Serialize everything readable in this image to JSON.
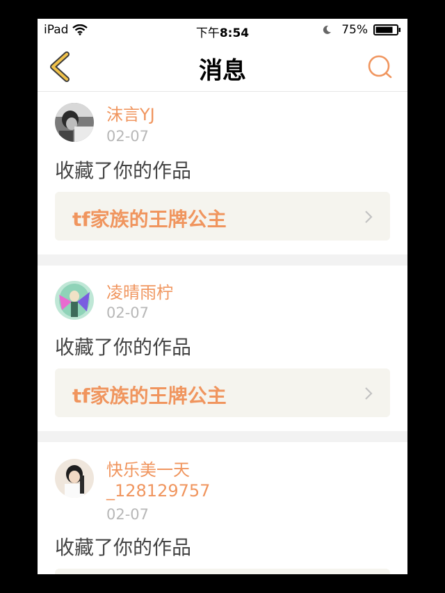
{
  "status": {
    "device": "iPad",
    "time_prefix": "下午",
    "time": "8:54",
    "battery": "75%"
  },
  "nav": {
    "title": "消息",
    "back_icon": "chevron-left-icon",
    "search_icon": "search-icon"
  },
  "colors": {
    "accent": "#f0955e",
    "back_arrow": "#e0a82e",
    "card_bg": "#f5f4ee",
    "date": "#b7b7b7",
    "separator": "#f2f2f2"
  },
  "messages": [
    {
      "username": "沫言YJ",
      "date": "02-07",
      "action": "收藏了你的作品",
      "work_title": "tf家族的王牌公主"
    },
    {
      "username": "凌晴雨柠",
      "date": "02-07",
      "action": "收藏了你的作品",
      "work_title": "tf家族的王牌公主"
    },
    {
      "username_line1": "快乐美一天",
      "username_line2": "_128129757",
      "date": "02-07",
      "action": "收藏了你的作品"
    }
  ]
}
